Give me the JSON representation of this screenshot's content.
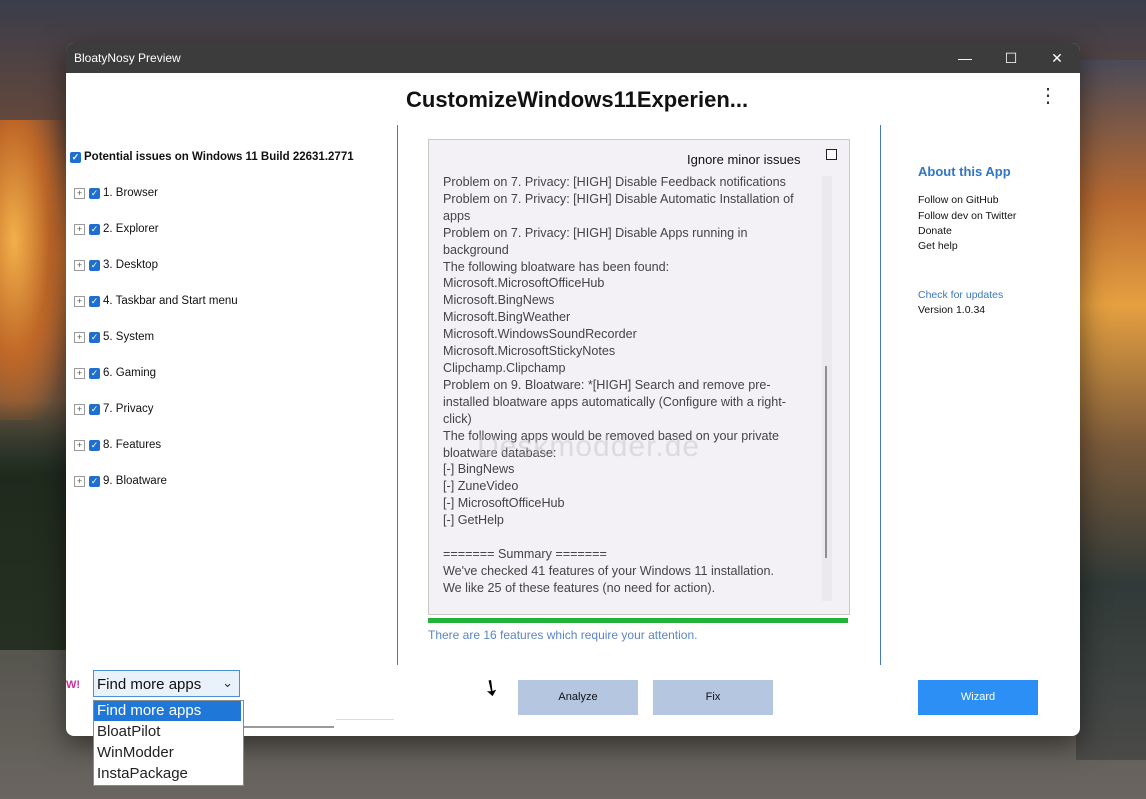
{
  "window": {
    "title": "BloatyNosy Preview"
  },
  "window_controls": {
    "minimize": "—",
    "maximize": "☐",
    "close": "✕"
  },
  "header": {
    "title": "CustomizeWindows11Experien...",
    "menu_icon": "more-vert-icon"
  },
  "tree": {
    "root_label": "Potential issues on Windows 11 Build 22631.2771",
    "items": [
      "1. Browser",
      "2. Explorer",
      "3. Desktop",
      "4. Taskbar and Start menu",
      "5. System",
      "6. Gaming",
      "7. Privacy",
      "8. Features",
      "9. Bloatware"
    ]
  },
  "log": {
    "ignore_label": "Ignore minor issues",
    "lines": [
      "Problem on 7. Privacy: [HIGH] Disable Feedback notifications",
      "Problem on 7. Privacy: [HIGH] Disable Automatic Installation of apps",
      "Problem on 7. Privacy: [HIGH] Disable Apps running in background",
      "The following bloatware has been found:",
      "Microsoft.MicrosoftOfficeHub",
      "Microsoft.BingNews",
      "Microsoft.BingWeather",
      "Microsoft.WindowsSoundRecorder",
      "Microsoft.MicrosoftStickyNotes",
      "Clipchamp.Clipchamp",
      "Problem on 9. Bloatware: *[HIGH] Search and remove pre-installed bloatware apps automatically (Configure with a right-click)",
      "The following apps would be removed based on your private bloatware database:",
      "[-] BingNews",
      "[-] ZuneVideo",
      "[-] MicrosoftOfficeHub",
      "[-] GetHelp",
      "",
      "======= Summary =======",
      "We've checked 41 features of your Windows 11 installation.",
      "We like 25 of these features (no need for action)."
    ],
    "watermark": "Deskmodder.de"
  },
  "progress": {
    "value_percent": 100,
    "color": "#22b23a"
  },
  "status": {
    "text": "There are 16 features which require your attention."
  },
  "sidebar": {
    "title": "About this App",
    "links": [
      "Follow on GitHub",
      "Follow dev on Twitter",
      "Donate",
      "Get help"
    ],
    "check_updates": "Check for updates",
    "version": "Version 1.0.34"
  },
  "bottom": {
    "logo": "W!",
    "find_more_selected": "Find more apps",
    "dropdown_options": [
      "Find more apps",
      "BloatPilot",
      "WinModder",
      "InstaPackage"
    ],
    "analyze_label": "Analyze",
    "fix_label": "Fix",
    "wizard_label": "Wizard"
  },
  "colors": {
    "accent": "#2b8ff5",
    "button": "#b4c6e0",
    "titlebar": "#3c3c3c",
    "link": "#2f76c8"
  }
}
